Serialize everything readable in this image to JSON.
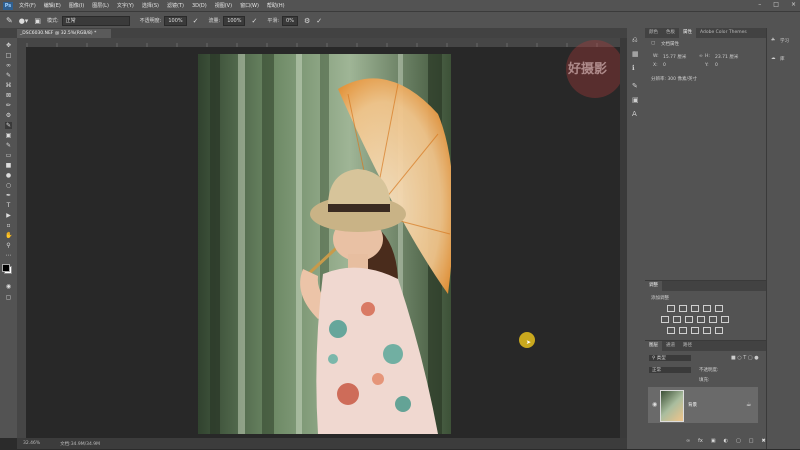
{
  "menu": {
    "logo": "Ps",
    "items": [
      "文件(F)",
      "编辑(E)",
      "图像(I)",
      "图层(L)",
      "文字(Y)",
      "选择(S)",
      "滤镜(T)",
      "3D(D)",
      "视图(V)",
      "窗口(W)",
      "帮助(H)"
    ]
  },
  "options": {
    "mode_label": "模式:",
    "mode_value": "正常",
    "opacity_label": "不透明度:",
    "opacity_value": "100%",
    "flow_label": "流量:",
    "flow_value": "100%",
    "smooth_label": "平滑:",
    "smooth_value": "0%"
  },
  "document": {
    "tab_title": "_DSC6030.NEF @ 32.5%(RGB/8) *",
    "zoom": "32.46%",
    "doc_size": "文档:34.9M/34.9M"
  },
  "properties_panel": {
    "tabs": [
      "颜色",
      "色板",
      "属性",
      "Adobe Color Themes"
    ],
    "active_tab": "属性",
    "doc_label": "文档属性",
    "w_label": "W:",
    "w_value": "15.77 厘米",
    "h_label": "H:",
    "h_value": "23.71 厘米",
    "x_label": "X:",
    "x_value": "0",
    "y_label": "Y:",
    "y_value": "0",
    "resolution": "分辨率: 300 像素/英寸"
  },
  "adjust_panel": {
    "tab": "调整",
    "add_label": "添加调整"
  },
  "layers_panel": {
    "tabs": [
      "图层",
      "通道",
      "路径"
    ],
    "kind_label": "类型",
    "blend_value": "正常",
    "opacity_label": "不透明度:",
    "fill_label": "填充:",
    "layer_name": "背景"
  },
  "far_right": {
    "learn": "学习",
    "libs": "库"
  },
  "watermark": "好摄影",
  "colors": {
    "accent_cursor": "#c9a81e"
  }
}
